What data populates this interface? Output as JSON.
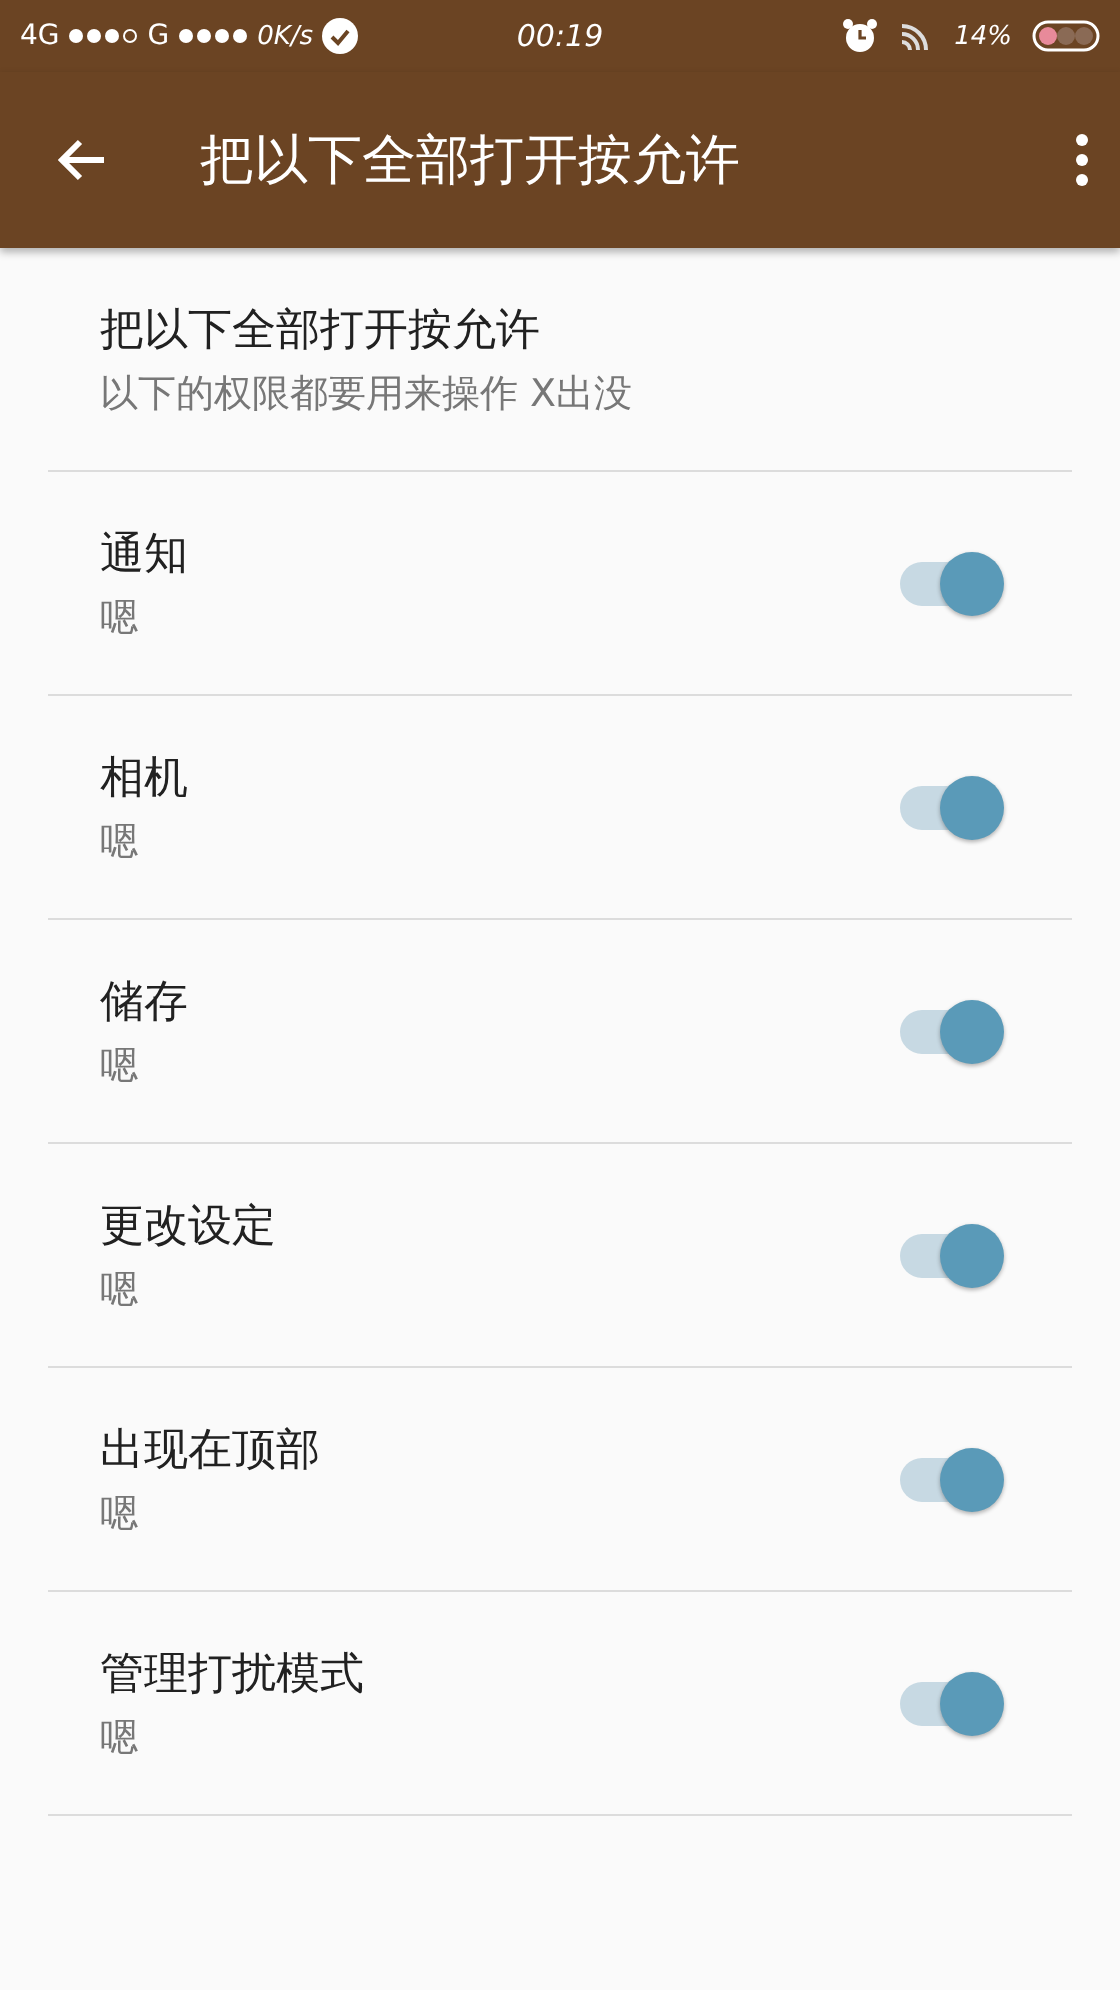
{
  "status_bar": {
    "network_1": "4G",
    "network_2": "G",
    "speed": "0K/s",
    "time": "00:19",
    "battery": "14%"
  },
  "app_bar": {
    "title": "把以下全部打开按允许"
  },
  "header": {
    "title": "把以下全部打开按允许",
    "subtitle": "以下的权限都要用来操作 X出没"
  },
  "permissions": [
    {
      "title": "通知",
      "summary": "嗯",
      "on": true
    },
    {
      "title": "相机",
      "summary": "嗯",
      "on": true
    },
    {
      "title": "储存",
      "summary": "嗯",
      "on": true
    },
    {
      "title": "更改设定",
      "summary": "嗯",
      "on": true
    },
    {
      "title": "出现在顶部",
      "summary": "嗯",
      "on": true
    },
    {
      "title": "管理打扰模式",
      "summary": "嗯",
      "on": true
    }
  ]
}
